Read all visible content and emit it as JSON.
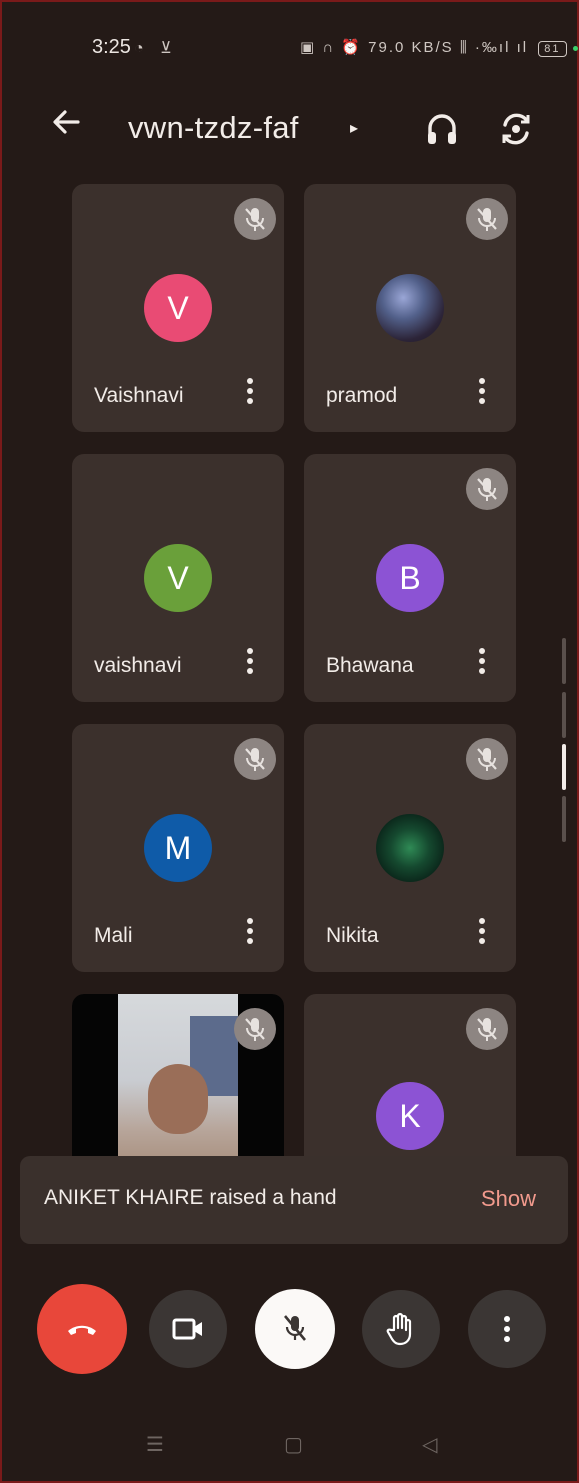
{
  "status_bar": {
    "time": "3:25",
    "left_icons": "◔ ⊻",
    "right_icons": "▣ ∩ ⏰ 79.0 KB/S  ⫼ ·‰ıl ıl",
    "battery": "81"
  },
  "header": {
    "meeting_code": "vwn-tzdz-faf",
    "chevron": "▸"
  },
  "participants": [
    {
      "name": "Vaishnavi",
      "initial": "V",
      "avatar_color": "#e94b74",
      "muted": true,
      "avatar_type": "letter"
    },
    {
      "name": "pramod",
      "initial": "",
      "avatar_color": "#3e3552",
      "muted": true,
      "avatar_type": "photo"
    },
    {
      "name": "vaishnavi",
      "initial": "V",
      "avatar_color": "#6aa03a",
      "muted": false,
      "avatar_type": "letter"
    },
    {
      "name": "Bhawana",
      "initial": "B",
      "avatar_color": "#8c53d4",
      "muted": true,
      "avatar_type": "letter"
    },
    {
      "name": "Mali",
      "initial": "M",
      "avatar_color": "#0f5ba8",
      "muted": true,
      "avatar_type": "letter"
    },
    {
      "name": "Nikita",
      "initial": "",
      "avatar_color": "#0d3324",
      "muted": true,
      "avatar_type": "photo"
    },
    {
      "name": "",
      "initial": "",
      "avatar_color": "#050505",
      "muted": true,
      "avatar_type": "video"
    },
    {
      "name": "",
      "initial": "K",
      "avatar_color": "#8c53d4",
      "muted": true,
      "avatar_type": "letter"
    }
  ],
  "toast": {
    "message": "ANIKET KHAIRE raised a hand",
    "action": "Show"
  },
  "controls": {
    "end_call_color": "#e8473a",
    "icons": [
      "end-call-icon",
      "camera-icon",
      "mic-off-icon",
      "raise-hand-icon",
      "more-vert-icon"
    ]
  },
  "nav_bar": {
    "recents": "☰",
    "home": "▢",
    "back": "◁"
  }
}
